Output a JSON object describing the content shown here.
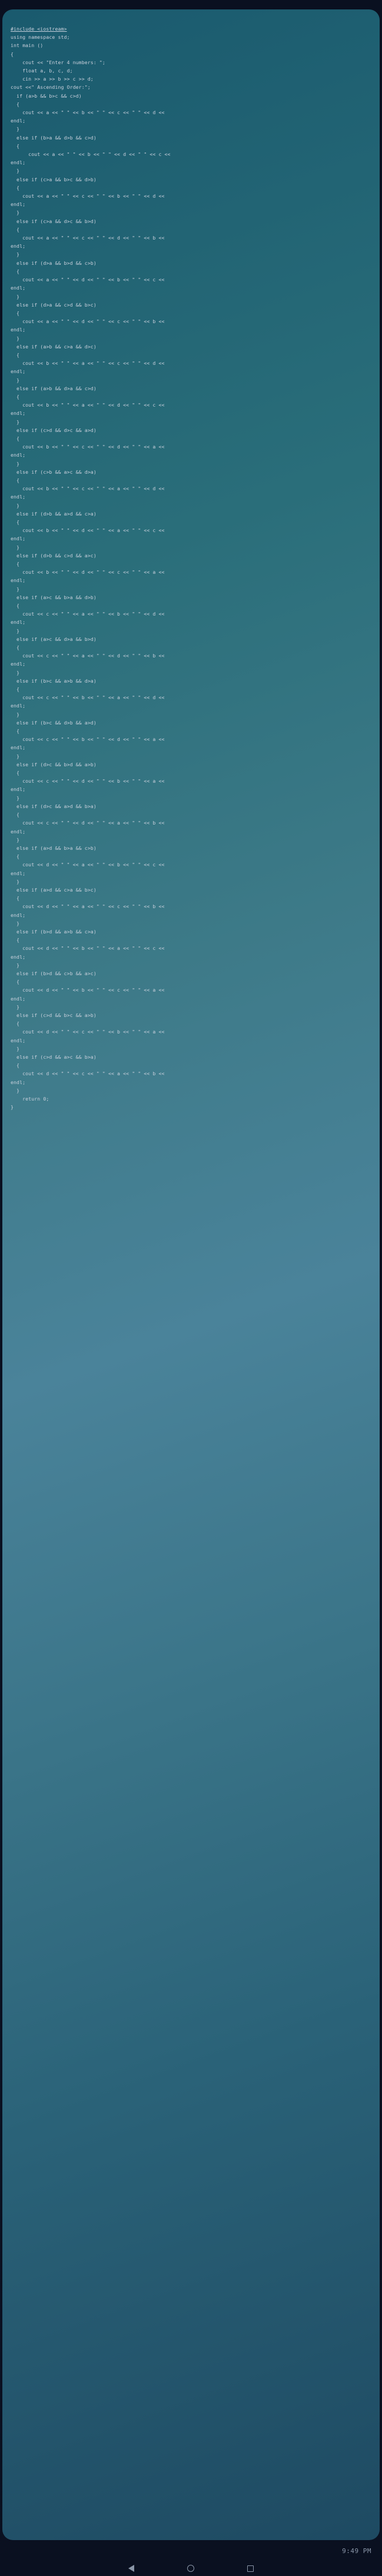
{
  "time": "9:49 PM",
  "code": {
    "l00": "#include <iostream>",
    "l01": "using namespace std;",
    "l02": "",
    "l03": "int main ()",
    "l04": "{",
    "l05": "    cout << \"Enter 4 numbers: \";",
    "l06": "    float a, b, c, d;",
    "l07": "    cin >> a >> b >> c >> d;",
    "l08": "cout <<\" Ascending Order:\";",
    "l09": "  if (a>b && b>c && c>d)",
    "l10": "  {",
    "l11": "    cout << a << \" \" << b << \" \" << c << \" \" << d << endl;",
    "l12": "  }",
    "l13": "  else if (b>a && d>b && c>d)",
    "l14": "  {",
    "l15": "      cout << a << \" \" << b << \" \" << d << \" \" << c << endl;",
    "l16": "  }",
    "l17": "  else if (c>a && b>c && d>b)",
    "l18": "  {",
    "l19": "    cout << a << \" \" << c << \" \" << b << \" \" << d << endl;",
    "l20": "  }",
    "l21": "  else if (c>a && d>c && b>d)",
    "l22": "  {",
    "l23": "    cout << a << \" \" << c << \" \" << d << \" \" << b << endl;",
    "l24": "  }",
    "l25": "  else if (d>a && b>d && c>b)",
    "l26": "  {",
    "l27": "    cout << a << \" \" << d << \" \" << b << \" \" << c << endl;",
    "l28": "  }",
    "l29": "  else if (d>a && c>d && b>c)",
    "l30": "  {",
    "l31": "    cout << a << \" \" << d << \" \" << c << \" \" << b << endl;",
    "l32": "  }",
    "l33": "  else if (a>b && c>a && d>c)",
    "l34": "  {",
    "l35": "    cout << b << \" \" << a << \" \" << c << \" \" << d << endl;",
    "l36": "  }",
    "l37": "  else if (a>b && d>a && c>d)",
    "l38": "  {",
    "l39": "    cout << b << \" \" << a << \" \" << d << \" \" << c << endl;",
    "l40": "  }",
    "l41": "  else if (c>d && d>c && a>d)",
    "l42": "  {",
    "l43": "    cout << b << \" \" << c << \" \" << d << \" \" << a << endl;",
    "l44": "  }",
    "l45": "  else if (c>b && a>c && d>a)",
    "l46": "  {",
    "l47": "    cout << b << \" \" << c << \" \" << a << \" \" << d << endl;",
    "l48": "  }",
    "l49": "  else if (d>b && a>d && c>a)",
    "l50": "  {",
    "l51": "    cout << b << \" \" << d << \" \" << a << \" \" << c << endl;",
    "l52": "  }",
    "l53": "  else if (d>b && c>d && a>c)",
    "l54": "  {",
    "l55": "    cout << b << \" \" << d << \" \" << c << \" \" << a << endl;",
    "l56": "  }",
    "l57": "  else if (a>c && b>a && d>b)",
    "l58": "  {",
    "l59": "    cout << c << \" \" << a << \" \" << b << \" \" << d << endl;",
    "l60": "  }",
    "l61": "  else if (a>c && d>a && b>d)",
    "l62": "  {",
    "l63": "    cout << c << \" \" << a << \" \" << d << \" \" << b << endl;",
    "l64": "  }",
    "l65": "  else if (b>c && a>b && d>a)",
    "l66": "  {",
    "l67": "    cout << c << \" \" << b << \" \" << a << \" \" << d << endl;",
    "l68": "  }",
    "l69": "  else if (b>c && d>b && a>d)",
    "l70": "  {",
    "l71": "    cout << c << \" \" << b << \" \" << d << \" \" << a << endl;",
    "l72": "  }",
    "l73": "  else if (d>c && b>d && a>b)",
    "l74": "  {",
    "l75": "    cout << c << \" \" << d << \" \" << b << \" \" << a << endl;",
    "l76": "  }",
    "l77": "  else if (d>c && a>d && b>a)",
    "l78": "  {",
    "l79": "    cout << c << \" \" << d << \" \" << a << \" \" << b << endl;",
    "l80": "  }",
    "l81": "  else if (a>d && b>a && c>b)",
    "l82": "  {",
    "l83": "    cout << d << \" \" << a << \" \" << b << \" \" << c << endl;",
    "l84": "  }",
    "l85": "  else if (a>d && c>a && b>c)",
    "l86": "  {",
    "l87": "    cout << d << \" \" << a << \" \" << c << \" \" << b << endl;",
    "l88": "  }",
    "l89": "  else if (b>d && a>b && c>a)",
    "l90": "  {",
    "l91": "    cout << d << \" \" << b << \" \" << a << \" \" << c << endl;",
    "l92": "  }",
    "l93": "  else if (b>d && c>b && a>c)",
    "l94": "  {",
    "l95": "    cout << d << \" \" << b << \" \" << c << \" \" << a << endl;",
    "l96": "  }",
    "l97": "  else if (c>d && b>c && a>b)",
    "l98": "  {",
    "l99": "    cout << d << \" \" << c << \" \" << b << \" \" << a << endl;",
    "l100": "  }",
    "l101": "  else if (c>d && a>c && b>a)",
    "l102": "  {",
    "l103": "    cout << d << \" \" << c << \" \" << a << \" \" << b << endl;",
    "l104": "  }",
    "l105": "    return 0;",
    "l106": "}"
  }
}
